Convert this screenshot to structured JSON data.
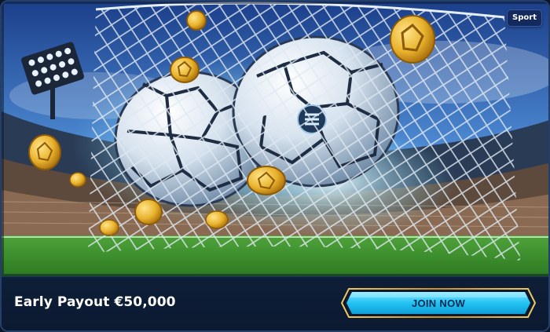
{
  "promo": {
    "badge": "Sport",
    "offer_text": "Early Payout €50,000",
    "cta_label": "JOIN NOW"
  },
  "hero": {
    "scene": "soccer-balls-in-net",
    "icons": [
      "soccer-ball-icon",
      "gold-coin-icon",
      "stadium-floodlight-icon",
      "goal-net-icon"
    ]
  },
  "colors": {
    "card_background": "#0e1d33",
    "button_fill": "#1ec8f5",
    "button_border": "#d9a441",
    "badge_background": "#152a5c",
    "text": "#ffffff"
  }
}
